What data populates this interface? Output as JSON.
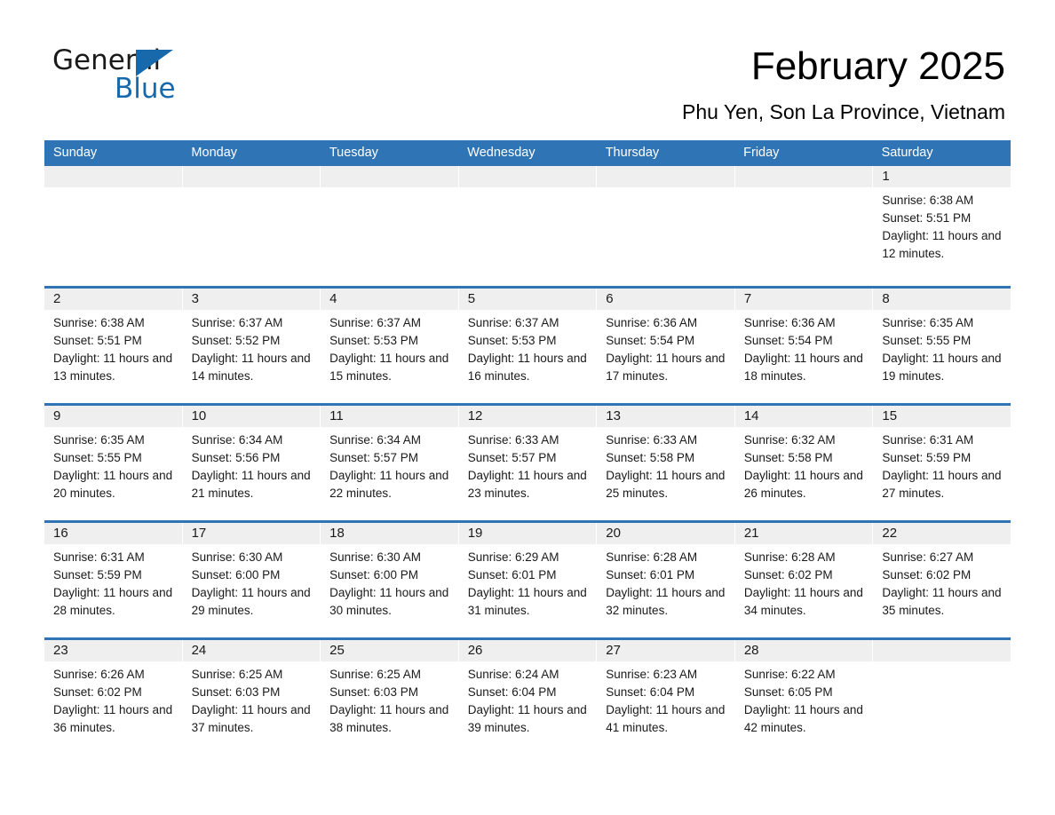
{
  "brand": {
    "name_part1": "General",
    "name_part2": "Blue",
    "triangle_color": "#1769ab",
    "accent_color": "#2f75b5"
  },
  "header": {
    "month_title": "February 2025",
    "location": "Phu Yen, Son La Province, Vietnam"
  },
  "calendar": {
    "weekdays": [
      "Sunday",
      "Monday",
      "Tuesday",
      "Wednesday",
      "Thursday",
      "Friday",
      "Saturday"
    ],
    "labels": {
      "sunrise_prefix": "Sunrise:",
      "sunset_prefix": "Sunset:",
      "daylight_prefix": "Daylight:"
    },
    "weeks": [
      [
        {
          "day": "",
          "sunrise": "",
          "sunset": "",
          "daylight": "",
          "empty": true
        },
        {
          "day": "",
          "sunrise": "",
          "sunset": "",
          "daylight": "",
          "empty": true
        },
        {
          "day": "",
          "sunrise": "",
          "sunset": "",
          "daylight": "",
          "empty": true
        },
        {
          "day": "",
          "sunrise": "",
          "sunset": "",
          "daylight": "",
          "empty": true
        },
        {
          "day": "",
          "sunrise": "",
          "sunset": "",
          "daylight": "",
          "empty": true
        },
        {
          "day": "",
          "sunrise": "",
          "sunset": "",
          "daylight": "",
          "empty": true
        },
        {
          "day": "1",
          "sunrise": "Sunrise: 6:38 AM",
          "sunset": "Sunset: 5:51 PM",
          "daylight": "Daylight: 11 hours and 12 minutes.",
          "empty": false
        }
      ],
      [
        {
          "day": "2",
          "sunrise": "Sunrise: 6:38 AM",
          "sunset": "Sunset: 5:51 PM",
          "daylight": "Daylight: 11 hours and 13 minutes.",
          "empty": false
        },
        {
          "day": "3",
          "sunrise": "Sunrise: 6:37 AM",
          "sunset": "Sunset: 5:52 PM",
          "daylight": "Daylight: 11 hours and 14 minutes.",
          "empty": false
        },
        {
          "day": "4",
          "sunrise": "Sunrise: 6:37 AM",
          "sunset": "Sunset: 5:53 PM",
          "daylight": "Daylight: 11 hours and 15 minutes.",
          "empty": false
        },
        {
          "day": "5",
          "sunrise": "Sunrise: 6:37 AM",
          "sunset": "Sunset: 5:53 PM",
          "daylight": "Daylight: 11 hours and 16 minutes.",
          "empty": false
        },
        {
          "day": "6",
          "sunrise": "Sunrise: 6:36 AM",
          "sunset": "Sunset: 5:54 PM",
          "daylight": "Daylight: 11 hours and 17 minutes.",
          "empty": false
        },
        {
          "day": "7",
          "sunrise": "Sunrise: 6:36 AM",
          "sunset": "Sunset: 5:54 PM",
          "daylight": "Daylight: 11 hours and 18 minutes.",
          "empty": false
        },
        {
          "day": "8",
          "sunrise": "Sunrise: 6:35 AM",
          "sunset": "Sunset: 5:55 PM",
          "daylight": "Daylight: 11 hours and 19 minutes.",
          "empty": false
        }
      ],
      [
        {
          "day": "9",
          "sunrise": "Sunrise: 6:35 AM",
          "sunset": "Sunset: 5:55 PM",
          "daylight": "Daylight: 11 hours and 20 minutes.",
          "empty": false
        },
        {
          "day": "10",
          "sunrise": "Sunrise: 6:34 AM",
          "sunset": "Sunset: 5:56 PM",
          "daylight": "Daylight: 11 hours and 21 minutes.",
          "empty": false
        },
        {
          "day": "11",
          "sunrise": "Sunrise: 6:34 AM",
          "sunset": "Sunset: 5:57 PM",
          "daylight": "Daylight: 11 hours and 22 minutes.",
          "empty": false
        },
        {
          "day": "12",
          "sunrise": "Sunrise: 6:33 AM",
          "sunset": "Sunset: 5:57 PM",
          "daylight": "Daylight: 11 hours and 23 minutes.",
          "empty": false
        },
        {
          "day": "13",
          "sunrise": "Sunrise: 6:33 AM",
          "sunset": "Sunset: 5:58 PM",
          "daylight": "Daylight: 11 hours and 25 minutes.",
          "empty": false
        },
        {
          "day": "14",
          "sunrise": "Sunrise: 6:32 AM",
          "sunset": "Sunset: 5:58 PM",
          "daylight": "Daylight: 11 hours and 26 minutes.",
          "empty": false
        },
        {
          "day": "15",
          "sunrise": "Sunrise: 6:31 AM",
          "sunset": "Sunset: 5:59 PM",
          "daylight": "Daylight: 11 hours and 27 minutes.",
          "empty": false
        }
      ],
      [
        {
          "day": "16",
          "sunrise": "Sunrise: 6:31 AM",
          "sunset": "Sunset: 5:59 PM",
          "daylight": "Daylight: 11 hours and 28 minutes.",
          "empty": false
        },
        {
          "day": "17",
          "sunrise": "Sunrise: 6:30 AM",
          "sunset": "Sunset: 6:00 PM",
          "daylight": "Daylight: 11 hours and 29 minutes.",
          "empty": false
        },
        {
          "day": "18",
          "sunrise": "Sunrise: 6:30 AM",
          "sunset": "Sunset: 6:00 PM",
          "daylight": "Daylight: 11 hours and 30 minutes.",
          "empty": false
        },
        {
          "day": "19",
          "sunrise": "Sunrise: 6:29 AM",
          "sunset": "Sunset: 6:01 PM",
          "daylight": "Daylight: 11 hours and 31 minutes.",
          "empty": false
        },
        {
          "day": "20",
          "sunrise": "Sunrise: 6:28 AM",
          "sunset": "Sunset: 6:01 PM",
          "daylight": "Daylight: 11 hours and 32 minutes.",
          "empty": false
        },
        {
          "day": "21",
          "sunrise": "Sunrise: 6:28 AM",
          "sunset": "Sunset: 6:02 PM",
          "daylight": "Daylight: 11 hours and 34 minutes.",
          "empty": false
        },
        {
          "day": "22",
          "sunrise": "Sunrise: 6:27 AM",
          "sunset": "Sunset: 6:02 PM",
          "daylight": "Daylight: 11 hours and 35 minutes.",
          "empty": false
        }
      ],
      [
        {
          "day": "23",
          "sunrise": "Sunrise: 6:26 AM",
          "sunset": "Sunset: 6:02 PM",
          "daylight": "Daylight: 11 hours and 36 minutes.",
          "empty": false
        },
        {
          "day": "24",
          "sunrise": "Sunrise: 6:25 AM",
          "sunset": "Sunset: 6:03 PM",
          "daylight": "Daylight: 11 hours and 37 minutes.",
          "empty": false
        },
        {
          "day": "25",
          "sunrise": "Sunrise: 6:25 AM",
          "sunset": "Sunset: 6:03 PM",
          "daylight": "Daylight: 11 hours and 38 minutes.",
          "empty": false
        },
        {
          "day": "26",
          "sunrise": "Sunrise: 6:24 AM",
          "sunset": "Sunset: 6:04 PM",
          "daylight": "Daylight: 11 hours and 39 minutes.",
          "empty": false
        },
        {
          "day": "27",
          "sunrise": "Sunrise: 6:23 AM",
          "sunset": "Sunset: 6:04 PM",
          "daylight": "Daylight: 11 hours and 41 minutes.",
          "empty": false
        },
        {
          "day": "28",
          "sunrise": "Sunrise: 6:22 AM",
          "sunset": "Sunset: 6:05 PM",
          "daylight": "Daylight: 11 hours and 42 minutes.",
          "empty": false
        },
        {
          "day": "",
          "sunrise": "",
          "sunset": "",
          "daylight": "",
          "empty": true
        }
      ]
    ]
  }
}
